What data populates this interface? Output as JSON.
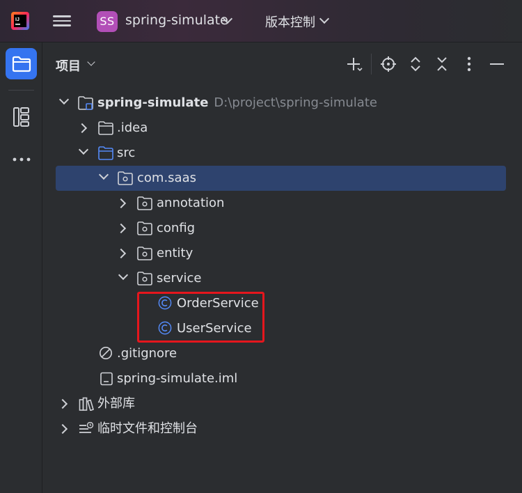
{
  "titlebar": {
    "app_logo_icon": "intellij-idea-logo",
    "menu_icon": "hamburger-menu-icon",
    "project_badge": "SS",
    "project_name": "spring-simulate",
    "vcs_label": "版本控制",
    "accent_badge_color": "#b24fb7"
  },
  "toolstrip": {
    "items": [
      {
        "name": "project-tool",
        "icon": "folder-icon",
        "active": true
      },
      {
        "name": "structure-tool",
        "icon": "structure-icon",
        "active": false
      },
      {
        "name": "more-tools",
        "icon": "more-horizontal-icon",
        "active": false
      }
    ]
  },
  "panel": {
    "title": "项目",
    "actions": [
      "add-icon",
      "locate-icon",
      "expand-all-icon",
      "collapse-all-icon",
      "more-vertical-icon",
      "minimize-icon"
    ]
  },
  "tree": [
    {
      "label": "spring-simulate",
      "path": "D:\\project\\spring-simulate",
      "icon": "module-folder-icon",
      "expanded": true,
      "bold": true
    },
    {
      "label": ".idea",
      "icon": "folder-icon",
      "expanded": false
    },
    {
      "label": "src",
      "icon": "source-folder-icon",
      "expanded": true
    },
    {
      "label": "com.saas",
      "icon": "package-icon",
      "expanded": true,
      "selected": true
    },
    {
      "label": "annotation",
      "icon": "package-icon",
      "expanded": false
    },
    {
      "label": "config",
      "icon": "package-icon",
      "expanded": false
    },
    {
      "label": "entity",
      "icon": "package-icon",
      "expanded": false
    },
    {
      "label": "service",
      "icon": "package-icon",
      "expanded": true
    },
    {
      "label": "OrderService",
      "icon": "class-icon"
    },
    {
      "label": "UserService",
      "icon": "class-icon"
    },
    {
      "label": ".gitignore",
      "icon": "ignore-file-icon"
    },
    {
      "label": "spring-simulate.iml",
      "icon": "iml-file-icon"
    },
    {
      "label": "外部库",
      "icon": "library-icon",
      "expanded": false
    },
    {
      "label": "临时文件和控制台",
      "icon": "scratches-icon",
      "expanded": false
    }
  ],
  "colors": {
    "selection": "#2e436e",
    "highlight_box": "#e5161d",
    "class_icon": "#548af7",
    "active_tool": "#3574f0"
  }
}
